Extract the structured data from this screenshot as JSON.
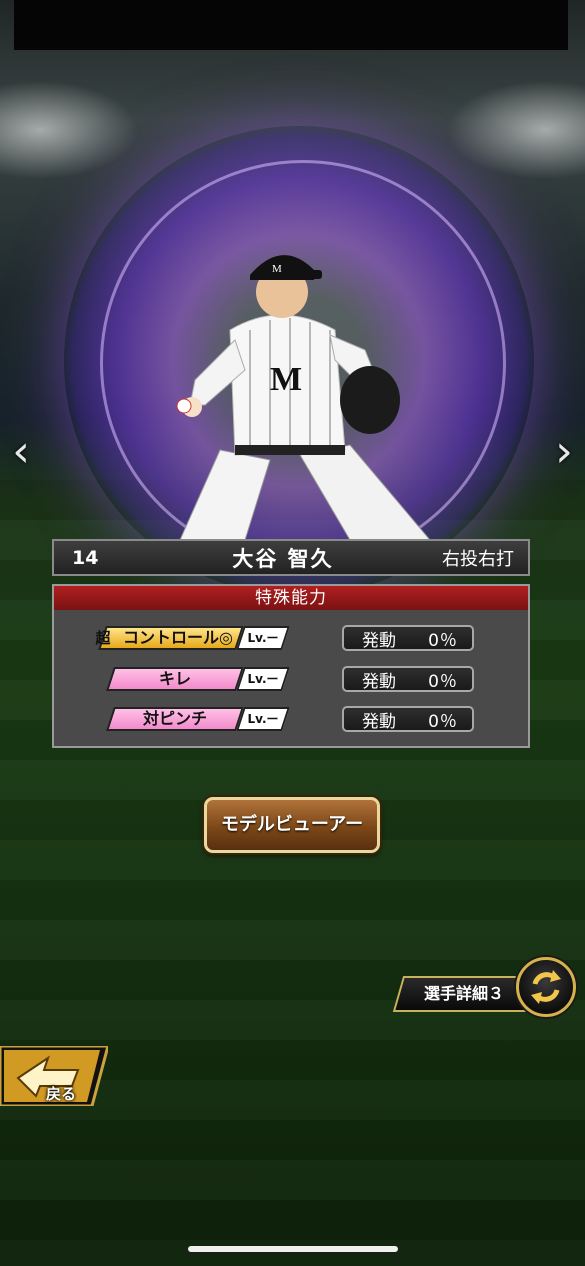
{
  "player": {
    "number": "14",
    "name": "大谷 智久",
    "handedness": "右投右打"
  },
  "abilities": {
    "header": "特殊能力",
    "items": [
      {
        "super_mark": "超",
        "name": "コントロール◎",
        "level": "Lv.ー",
        "stat_label": "発動",
        "stat_value": "0％",
        "tier": "gold"
      },
      {
        "name": "キレ",
        "level": "Lv.ー",
        "stat_label": "発動",
        "stat_value": "0％",
        "tier": "pink"
      },
      {
        "name": "対ピンチ",
        "level": "Lv.ー",
        "stat_label": "発動",
        "stat_value": "0％",
        "tier": "pink"
      }
    ]
  },
  "buttons": {
    "model_viewer": "モデルビューアー",
    "player_detail": "選手詳細３",
    "back": "戻る"
  },
  "icons": {
    "prev": "chevron-left-icon",
    "next": "chevron-right-icon",
    "switch": "swap-arrows-icon",
    "back": "back-arrow-icon"
  },
  "colors": {
    "ability_header": "#b01f20",
    "gold_chip": "#e6a81a",
    "pink_chip": "#f28acb",
    "aura": "#a060ff"
  }
}
